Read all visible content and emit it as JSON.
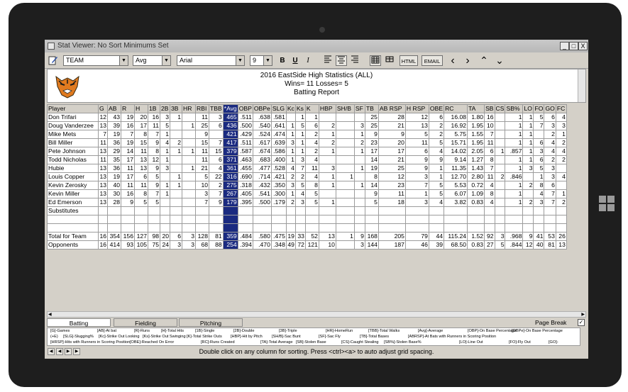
{
  "window": {
    "title": "Stat Viewer: No Sort Minimums Set",
    "min": "_",
    "max": "□",
    "close": "X"
  },
  "toolbar": {
    "team_value": "TEAM",
    "sort_value": "Avg",
    "font_value": "Arial",
    "size_value": "9",
    "bold": "B",
    "underline": "U",
    "italic": "I",
    "html": "HTML",
    "email": "EMAIL",
    "prev": "‹",
    "next": "›",
    "up": "⌃",
    "down": "⌄"
  },
  "report": {
    "title": "2016 EastSide High Statistics (ALL)",
    "record": "Wins=  11 Losses=  5",
    "subtitle": "Batting Report"
  },
  "columns": [
    "Player",
    "G",
    "AB",
    "R",
    "H",
    "1B",
    "2B",
    "3B",
    "HR",
    "RBI",
    "TBB",
    "*Avg",
    "OBP",
    "OBPe",
    "SLG",
    "Kc",
    "Ks",
    "K",
    "HBP",
    "SH/B",
    "SF",
    "TB",
    "AB RSP",
    "H RSP",
    "OBE",
    "RC",
    "TA",
    "SB",
    "CS",
    "SB%",
    "LO",
    "FO",
    "GO",
    "FC"
  ],
  "rows": [
    [
      "Don Trifari",
      "12",
      "43",
      "19",
      "20",
      "16",
      "3",
      "1",
      "",
      "11",
      "3",
      "465",
      ".511",
      ".638",
      ".581",
      "",
      "1",
      "1",
      "",
      "",
      "",
      "25",
      "28",
      "12",
      "6",
      "16.08",
      "1.80",
      "16",
      "",
      "1",
      "1",
      "5",
      "6",
      "4"
    ],
    [
      "Doug Vanderzee",
      "13",
      "39",
      "16",
      "17",
      "11",
      "5",
      "",
      "1",
      "25",
      "6",
      "436",
      ".500",
      ".540",
      ".641",
      "1",
      "5",
      "6",
      "2",
      "",
      "3",
      "25",
      "21",
      "13",
      "2",
      "16.92",
      "1.95",
      "10",
      "",
      "1",
      "1",
      "7",
      "3",
      "3"
    ],
    [
      "Mike Mets",
      "7",
      "19",
      "7",
      "8",
      "7",
      "1",
      "",
      "",
      "9",
      "",
      "421",
      ".429",
      ".524",
      ".474",
      "1",
      "1",
      "2",
      "1",
      "",
      "1",
      "9",
      "9",
      "5",
      "2",
      "5.75",
      "1.55",
      "7",
      "",
      "1",
      "1",
      "",
      "2",
      "1"
    ],
    [
      "Bill Miller",
      "11",
      "36",
      "19",
      "15",
      "9",
      "4",
      "2",
      "",
      "15",
      "7",
      "417",
      ".511",
      ".617",
      ".639",
      "3",
      "1",
      "4",
      "2",
      "",
      "2",
      "23",
      "20",
      "11",
      "5",
      "15.71",
      "1.95",
      "11",
      "",
      "1",
      "1",
      "6",
      "4",
      "2"
    ],
    [
      "Pete Johnson",
      "13",
      "29",
      "14",
      "11",
      "8",
      "1",
      "1",
      "1",
      "11",
      "15",
      "379",
      ".587",
      ".674",
      ".586",
      "1",
      "1",
      "2",
      "1",
      "",
      "1",
      "17",
      "17",
      "6",
      "4",
      "14.02",
      "2.05",
      "6",
      "1",
      ".857",
      "1",
      "3",
      "4",
      "4"
    ],
    [
      "Todd Nicholas",
      "11",
      "35",
      "17",
      "13",
      "12",
      "1",
      "",
      "",
      "11",
      "6",
      "371",
      ".463",
      ".683",
      ".400",
      "1",
      "3",
      "4",
      "",
      "",
      "",
      "14",
      "21",
      "9",
      "9",
      "9.14",
      "1.27",
      "8",
      "",
      "1",
      "1",
      "6",
      "2",
      "2"
    ],
    [
      "Hubie",
      "13",
      "36",
      "11",
      "13",
      "9",
      "3",
      "",
      "1",
      "21",
      "4",
      "361",
      ".455",
      ".477",
      ".528",
      "4",
      "7",
      "11",
      "3",
      "",
      "1",
      "19",
      "25",
      "9",
      "1",
      "11.35",
      "1.43",
      "7",
      "",
      "1",
      "3",
      "5",
      "3",
      ""
    ],
    [
      "Louis Copper",
      "13",
      "19",
      "17",
      "6",
      "5",
      "",
      "1",
      "",
      "5",
      "22",
      "316",
      ".690",
      ".714",
      ".421",
      "2",
      "2",
      "4",
      "1",
      "1",
      "",
      "8",
      "12",
      "3",
      "1",
      "12.70",
      "2.80",
      "11",
      "2",
      ".846",
      "",
      "1",
      "3",
      "4"
    ],
    [
      "Kevin Zerosky",
      "13",
      "40",
      "11",
      "11",
      "9",
      "1",
      "1",
      "",
      "10",
      "2",
      "275",
      ".318",
      ".432",
      ".350",
      "3",
      "5",
      "8",
      "1",
      "",
      "1",
      "14",
      "23",
      "7",
      "5",
      "5.53",
      "0.72",
      "4",
      "",
      "1",
      "2",
      "8",
      "6",
      ""
    ],
    [
      "Kevin Miller",
      "13",
      "30",
      "16",
      "8",
      "7",
      "1",
      "",
      "",
      "3",
      "7",
      "267",
      ".405",
      ".541",
      ".300",
      "1",
      "4",
      "5",
      "",
      "",
      "",
      "9",
      "11",
      "1",
      "5",
      "6.07",
      "1.09",
      "8",
      "",
      "1",
      "",
      "4",
      "7",
      "1"
    ],
    [
      "Ed Emerson",
      "13",
      "28",
      "9",
      "5",
      "5",
      "",
      "",
      "",
      "7",
      "9",
      "179",
      ".395",
      ".500",
      ".179",
      "2",
      "3",
      "5",
      "1",
      "",
      "",
      "5",
      "18",
      "3",
      "4",
      "3.82",
      "0.83",
      "4",
      "",
      "1",
      "2",
      "3",
      "7",
      "2"
    ]
  ],
  "substitutes_label": "Substitutes",
  "totals": [
    [
      "Total for Team",
      "16",
      "354",
      "156",
      "127",
      "98",
      "20",
      "6",
      "3",
      "128",
      "81",
      "359",
      ".484",
      ".580",
      ".475",
      "19",
      "33",
      "52",
      "13",
      "1",
      "9",
      "168",
      "205",
      "79",
      "44",
      "115.24",
      "1.52",
      "92",
      "3",
      ".968",
      "9",
      "41",
      "53",
      "26"
    ],
    [
      "Opponents",
      "16",
      "414",
      "93",
      "105",
      "75",
      "24",
      "3",
      "3",
      "68",
      "88",
      "254",
      ".394",
      ".470",
      ".348",
      "49",
      "72",
      "121",
      "10",
      "",
      "3",
      "144",
      "187",
      "46",
      "39",
      "68.50",
      "0.83",
      "27",
      "5",
      ".844",
      "12",
      "40",
      "81",
      "13"
    ]
  ],
  "tabs": {
    "batting": "Batting",
    "fielding": "Fielding",
    "pitching": "Pitching",
    "page_break": "Page Break"
  },
  "legend": [
    [
      "[G]-Games",
      "[AB]-At bat",
      "[R]-Runs",
      "[H]-Total Hits",
      "[1B]-Single",
      "[2B]-Double",
      "[3B]-Triple",
      "[HR]-HomeRun",
      "[TBB]-Total Walks",
      "[Avg]-Average",
      "[OBP]-On Base Percentage",
      "[OBPe]-On Base Percentage"
    ],
    [
      "(+E)",
      "[SLG]-Slugging%",
      "[Kc]-Strike Out Looking",
      "[Ks]-Strike Out Swinging",
      "[K]-Total Strike Outs",
      "[HBP]-Hit by Pitch",
      "[SH/B]-Sac Bunt",
      "[SF]-Sac Fly",
      "[TB]-Total Bases",
      "[ABRSP]-At Bats with Runners in Scoring Position"
    ],
    [
      "[HRSP]-Hits with Runners in Scoring Position",
      "[OBE]-Reached On Error",
      "[RC]-Runs Created",
      "[TA]-Total Average",
      "[SB]-Stolen Base",
      "[CS]-Caught Stealing",
      "[SB%]-Stolen Base%",
      "[LO]-Line Out",
      "[FO]-Fly Out",
      "[GO]-"
    ]
  ],
  "status_text": "Double click on any column for sorting. Press <ctrl><a> to auto adjust grid spacing."
}
